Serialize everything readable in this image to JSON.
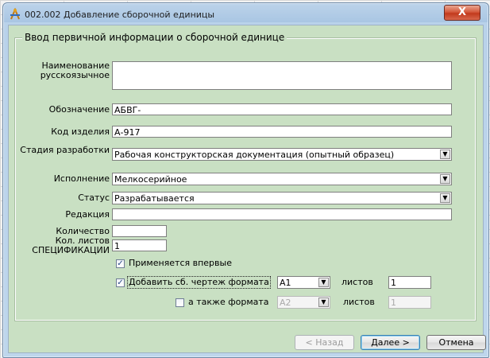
{
  "window": {
    "title": "002.002 Добавление сборочной единицы",
    "close_label": "X"
  },
  "group": {
    "legend": "Ввод первичной информации о сборочной единице"
  },
  "form": {
    "name_label": "Наименование русскоязычное",
    "name_value": "",
    "designation_label": "Обозначение",
    "designation_value": "АБВГ-",
    "product_code_label": "Код изделия",
    "product_code_value": "А-917",
    "stage_label": "Стадия разработки",
    "stage_value": "Рабочая конструкторская документация (опытный образец)",
    "execution_label": "Исполнение",
    "execution_value": "Мелкосерийное",
    "status_label": "Статус",
    "status_value": "Разрабатывается",
    "edition_label": "Редакция",
    "edition_value": "",
    "quantity_label": "Количество",
    "quantity_value": "",
    "spec_sheets_label": "Кол. листов СПЕЦИФИКАЦИИ",
    "spec_sheets_value": "1",
    "first_use_label": "Применяется впервые",
    "first_use_checked": true,
    "add_drawing_label": "Добавить сб. чертеж формата",
    "add_drawing_checked": true,
    "add_drawing_format": "А1",
    "add_drawing_sheets_label": "листов",
    "add_drawing_sheets_value": "1",
    "also_format_label": "а также формата",
    "also_format_checked": false,
    "also_format_value": "А2",
    "also_sheets_label": "листов",
    "also_sheets_value": "1"
  },
  "buttons": {
    "back": "< Назад",
    "next": "Далее >",
    "cancel": "Отмена"
  },
  "icons": {
    "app": "compass-tools-icon",
    "check": "✓",
    "dropdown": "▼"
  }
}
